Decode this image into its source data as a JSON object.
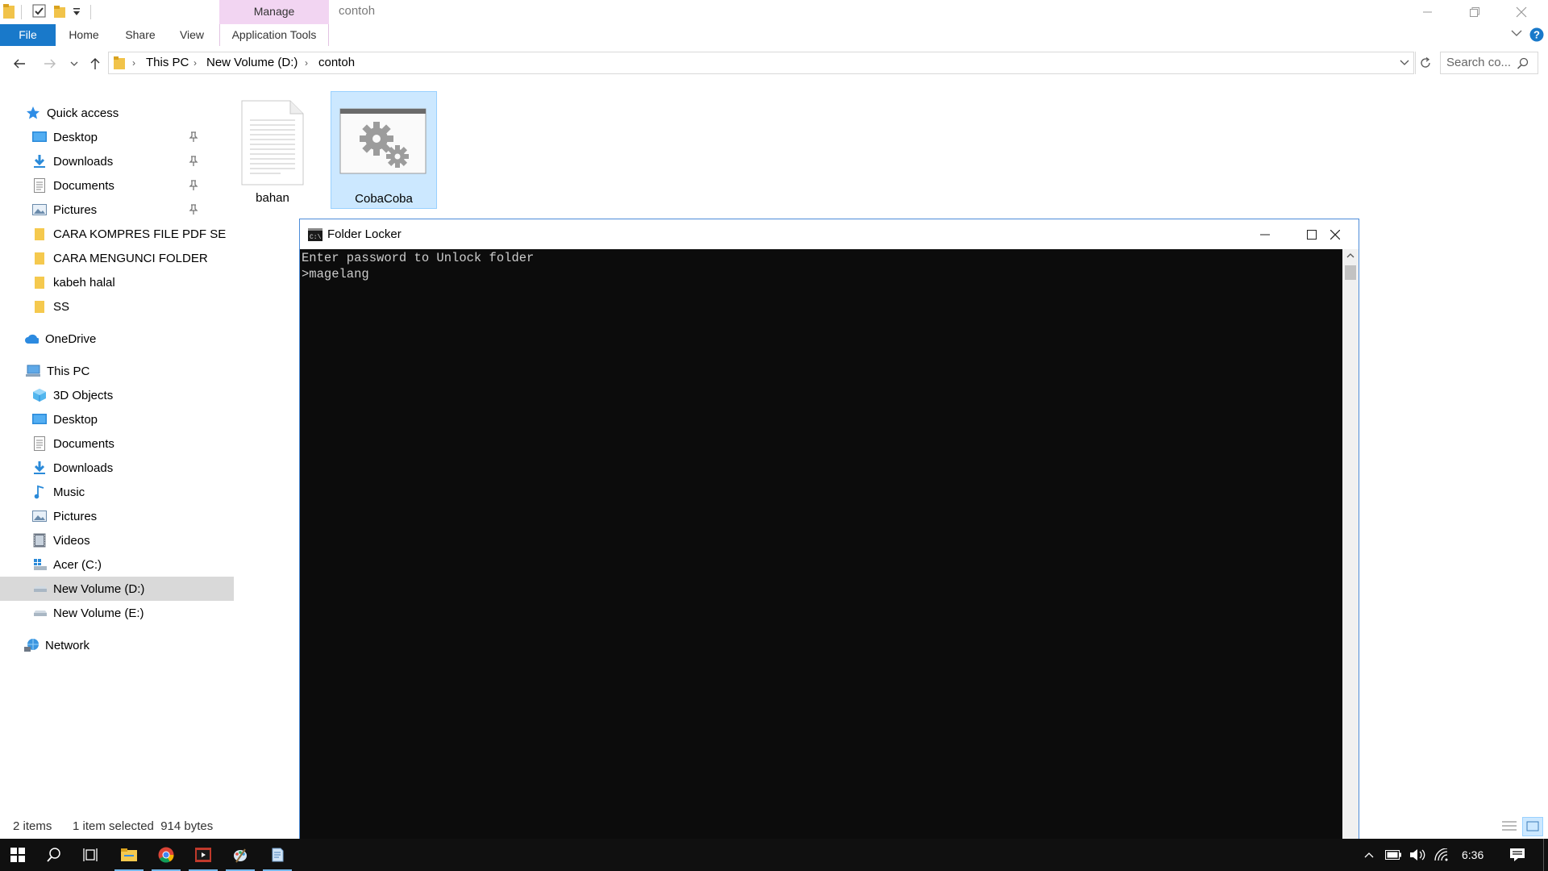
{
  "titlebar": {
    "manage_label": "Manage",
    "window_title": "contoh"
  },
  "ribbon": {
    "tabs": [
      "File",
      "Home",
      "Share",
      "View",
      "Application Tools"
    ]
  },
  "address": {
    "crumbs": [
      "This PC",
      "New Volume (D:)",
      "contoh"
    ]
  },
  "search": {
    "placeholder": "Search co..."
  },
  "nav": {
    "quick_access": "Quick access",
    "quick_items": [
      "Desktop",
      "Downloads",
      "Documents",
      "Pictures",
      "CARA KOMPRES FILE PDF SE",
      "CARA MENGUNCI FOLDER",
      "kabeh halal",
      "SS"
    ],
    "onedrive": "OneDrive",
    "this_pc": "This PC",
    "pc_items": [
      "3D Objects",
      "Desktop",
      "Documents",
      "Downloads",
      "Music",
      "Pictures",
      "Videos",
      "Acer (C:)",
      "New Volume (D:)",
      "New Volume (E:)"
    ],
    "network": "Network"
  },
  "files": [
    {
      "name": "bahan"
    },
    {
      "name": "CobaCoba"
    }
  ],
  "status": {
    "items": "2 items",
    "selection": "1 item selected  914 bytes"
  },
  "console": {
    "title": "Folder Locker",
    "lines": [
      "Enter password to Unlock folder",
      ">magelang"
    ]
  },
  "taskbar": {
    "time": "6:36"
  },
  "colors": {
    "accent": "#1979ca",
    "selection": "#cce8ff",
    "manage_tab": "#f2d5f2",
    "console_bg": "#0c0c0c",
    "taskbar_bg": "#101010"
  }
}
